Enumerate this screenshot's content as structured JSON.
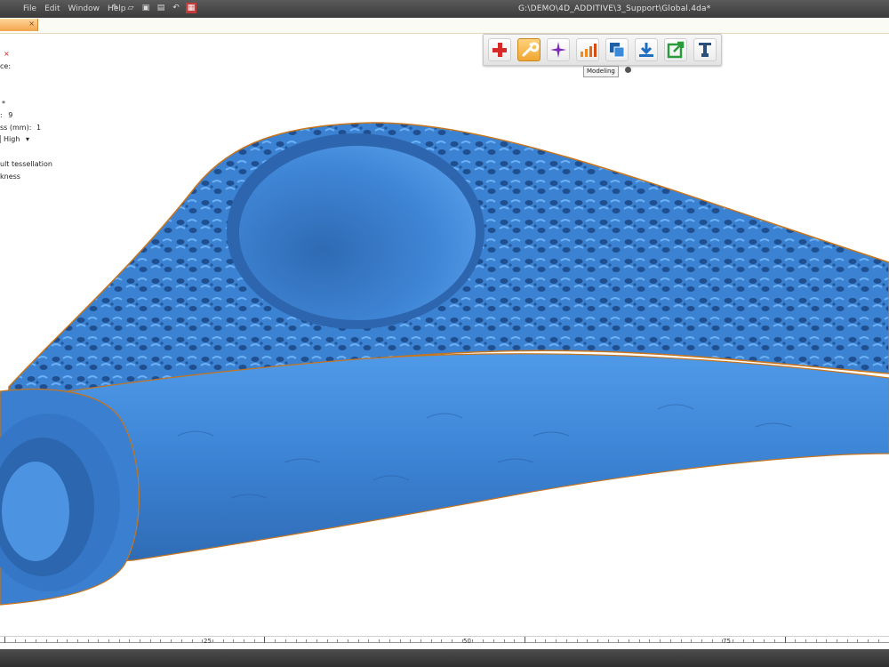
{
  "menu": [
    "File",
    "Edit",
    "Window",
    "Help"
  ],
  "window_title": "G:\\DEMO\\4D_ADDITIVE\\3_Support\\Global.4da*",
  "tab": {
    "close_label": "×"
  },
  "props": {
    "item1": "×",
    "item2": "ce:",
    "item3": "*",
    "item4_label": ":",
    "item4_value": "9",
    "item5_label": "ss (mm):",
    "item5_value": "1",
    "item6_value": "High",
    "item6_arrow": "▾",
    "item7": "ult tessellation",
    "item8": "kness"
  },
  "toolbar": {
    "buttons": [
      {
        "name": "add-button",
        "icon": "plus-icon"
      },
      {
        "name": "modeling-button",
        "icon": "wrench-icon",
        "active": true
      },
      {
        "name": "sparkle-button",
        "icon": "star-icon"
      },
      {
        "name": "analysis-button",
        "icon": "bar-chart-icon"
      },
      {
        "name": "layers-button",
        "icon": "copy-icon"
      },
      {
        "name": "import-button",
        "icon": "download-icon"
      },
      {
        "name": "export-button",
        "icon": "export-icon"
      },
      {
        "name": "support-button",
        "icon": "support-icon"
      }
    ],
    "tooltip": "Modeling"
  },
  "ruler": {
    "labels": [
      "25",
      "50",
      "75"
    ]
  },
  "colors": {
    "model_blue": "#3a7fd0",
    "toolbar_active": "#f0a632",
    "title_bar": "#444444"
  }
}
